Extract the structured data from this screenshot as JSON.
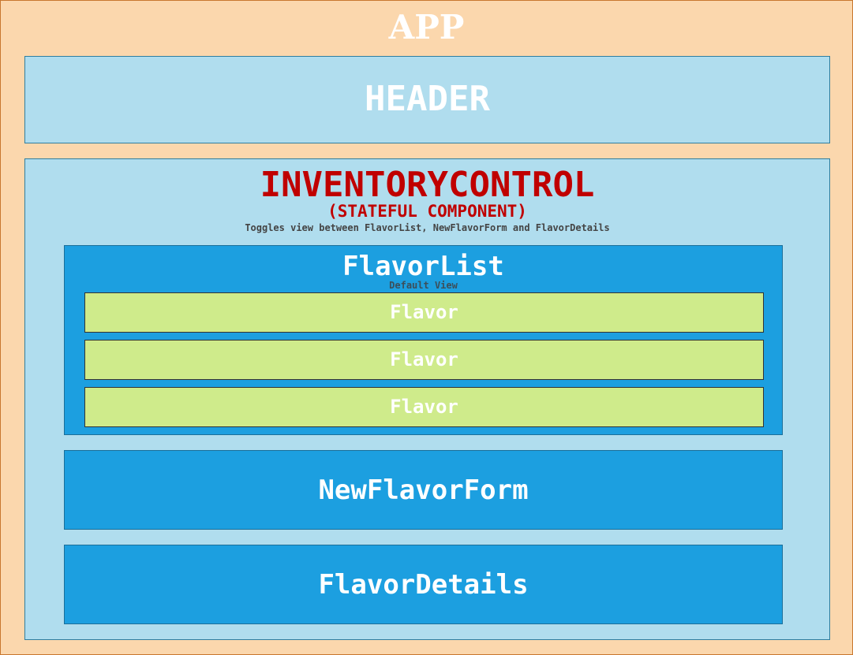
{
  "app": {
    "title": "APP"
  },
  "header": {
    "title": "HEADER"
  },
  "inventory_control": {
    "title": "INVENTORYCONTROL",
    "subtitle": "(STATEFUL COMPONENT)",
    "description": "Toggles view between FlavorList, NewFlavorForm and FlavorDetails"
  },
  "flavor_list": {
    "title": "FlavorList",
    "note": "Default View",
    "items": [
      {
        "label": "Flavor"
      },
      {
        "label": "Flavor"
      },
      {
        "label": "Flavor"
      }
    ]
  },
  "new_flavor_form": {
    "title": "NewFlavorForm"
  },
  "flavor_details": {
    "title": "FlavorDetails"
  },
  "colors": {
    "app_background": "#fbd7ad",
    "container_background": "#b0ddee",
    "component_background": "#1c9fe0",
    "flavor_background": "#cfeb8b",
    "stateful_title": "#c00000"
  }
}
